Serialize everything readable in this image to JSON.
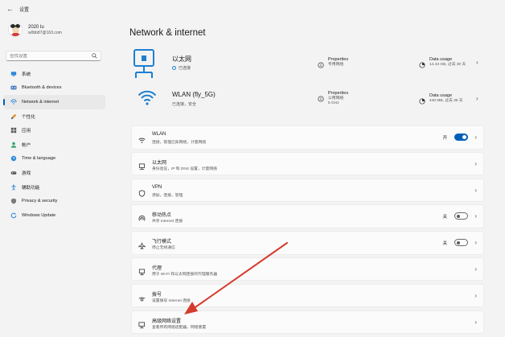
{
  "window": {
    "title": "设置"
  },
  "profile": {
    "name": "2020 lu",
    "email": "w0bb87@163.com"
  },
  "search": {
    "placeholder": "查找设置"
  },
  "sidebar": {
    "items": [
      {
        "label": "系统",
        "icon": "monitor-icon"
      },
      {
        "label": "Bluetooth & devices",
        "icon": "bluetooth-icon"
      },
      {
        "label": "Network & internet",
        "icon": "network-icon",
        "active": true
      },
      {
        "label": "个性化",
        "icon": "brush-icon"
      },
      {
        "label": "应用",
        "icon": "apps-icon"
      },
      {
        "label": "帐户",
        "icon": "person-icon"
      },
      {
        "label": "Time & language",
        "icon": "globe-clock-icon"
      },
      {
        "label": "游戏",
        "icon": "gamepad-icon"
      },
      {
        "label": "辅助功能",
        "icon": "accessibility-icon"
      },
      {
        "label": "Privacy & security",
        "icon": "shield-icon"
      },
      {
        "label": "Windows Update",
        "icon": "update-icon"
      }
    ]
  },
  "main": {
    "title": "Network & internet",
    "ethernet": {
      "name": "以太网",
      "status": "已连接",
      "properties_title": "Properties",
      "properties_sub": "专用网络",
      "data_title": "Data usage",
      "data_sub": "14.43 GB, 过去 30 天"
    },
    "wlan": {
      "name": "WLAN (fly_5G)",
      "status": "已连接，安全",
      "properties_title": "Properties",
      "properties_sub1": "公用网络",
      "properties_sub2": "5 GHz",
      "data_title": "Data usage",
      "data_sub": "440 MB, 过去 30 天"
    },
    "rows": [
      {
        "title": "WLAN",
        "desc": "连接，管理已知网络，计量网络",
        "state": "开",
        "toggle": "on",
        "icon": "wifi-icon"
      },
      {
        "title": "以太网",
        "desc": "身份验证，IP 和 DNS 设置，计量网络",
        "icon": "ethernet-icon"
      },
      {
        "title": "VPN",
        "desc": "添加，连接，管理",
        "icon": "vpn-shield-icon"
      },
      {
        "title": "移动热点",
        "desc": "共享 Internet 连接",
        "state": "关",
        "toggle": "off",
        "icon": "hotspot-icon"
      },
      {
        "title": "飞行模式",
        "desc": "停止无线通信",
        "state": "关",
        "toggle": "off",
        "icon": "airplane-icon"
      },
      {
        "title": "代理",
        "desc": "用于 Wi-Fi 和以太网连接的代理服务器",
        "icon": "proxy-icon"
      },
      {
        "title": "拨号",
        "desc": "设置拨号 Internet 连接",
        "icon": "dialup-icon"
      },
      {
        "title": "高级网络设置",
        "desc": "查看所有网络适配器，网络重置",
        "icon": "advanced-network-icon"
      }
    ]
  },
  "colors": {
    "accent": "#005fb8",
    "annotation_arrow": "#d63a2c"
  }
}
